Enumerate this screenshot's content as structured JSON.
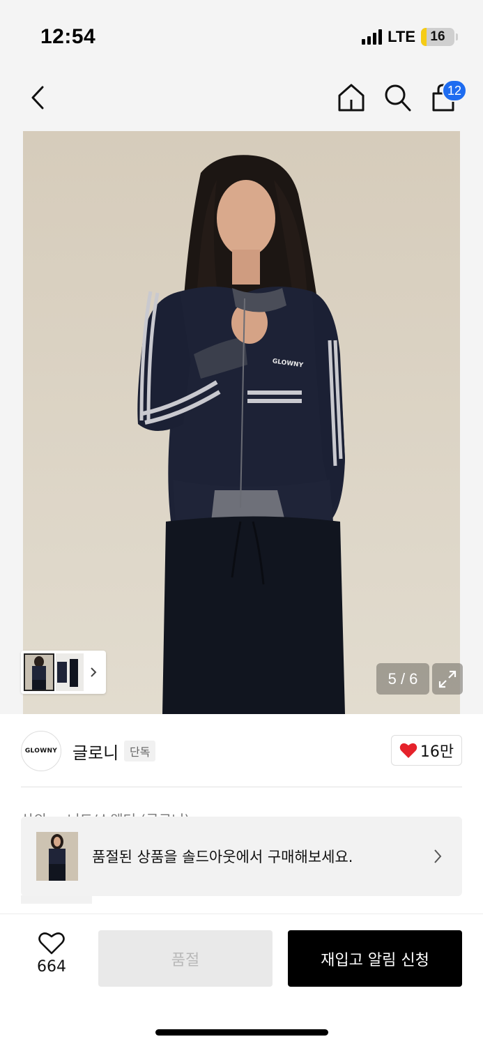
{
  "status_bar": {
    "time": "12:54",
    "network": "LTE",
    "battery": "16",
    "battery_level": 0.16
  },
  "nav": {
    "back_icon": "chevron-left-icon",
    "home_icon": "home-icon",
    "search_icon": "search-icon",
    "cart_icon": "shopping-bag-icon",
    "cart_count": "12",
    "badge_color": "#1e6cf0"
  },
  "gallery": {
    "counter": "5 / 6",
    "current": 5,
    "total": 6,
    "expand_icon": "expand-icon",
    "logo_on_garment": "GLOWNY"
  },
  "brand": {
    "logo_text": "GLOWNY",
    "name": "글로니",
    "tag": "단독",
    "like_icon": "heart-filled-icon",
    "like_count": "16만",
    "like_color": "#e5222b"
  },
  "breadcrumb_peek": "상의 > 니트/스웨터 (글로니)",
  "soldout_banner": {
    "text": "품절된 상품을 솔드아웃에서 구매해보세요.",
    "chevron_icon": "chevron-right-icon"
  },
  "bottom_bar": {
    "wish_icon": "heart-outline-icon",
    "wish_count": "664",
    "soldout_label": "품절",
    "restock_label": "재입고 알림 신청"
  }
}
